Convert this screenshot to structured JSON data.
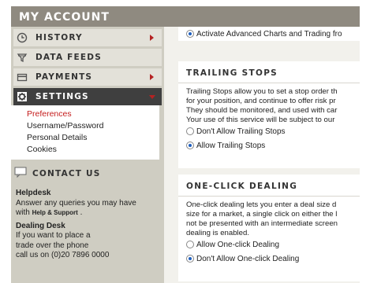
{
  "sidebar": {
    "title": "MY ACCOUNT",
    "menu": [
      {
        "label": "HISTORY",
        "icon": "history-icon",
        "arrow": "right"
      },
      {
        "label": "DATA FEEDS",
        "icon": "filter-icon",
        "arrow": "none"
      },
      {
        "label": "PAYMENTS",
        "icon": "card-icon",
        "arrow": "right"
      },
      {
        "label": "SETTINGS",
        "icon": "gear-icon",
        "arrow": "down",
        "active": true
      }
    ],
    "submenu": [
      "Preferences",
      "Username/Password",
      "Personal Details",
      "Cookies"
    ],
    "contact": {
      "title": "CONTACT US",
      "helpdesk_title": "Helpdesk",
      "helpdesk_text": "Answer any queries you may have",
      "helpdesk_with": "with",
      "helpdesk_link": "Help & Support",
      "helpdesk_end": ".",
      "dealing_title": "Dealing Desk",
      "dealing_line1": "If you want to place a",
      "dealing_line2": "trade over the phone",
      "dealing_line3": "call us on (0)20 7896 0000"
    }
  },
  "main": {
    "top_option": "Activate Advanced Charts and Trading fro",
    "trailing": {
      "title": "TRAILING STOPS",
      "lines": [
        "Trailing Stops allow you to set a stop order th",
        "for your position, and continue to offer risk pr",
        "They should be monitored, and used with car",
        "Your use of this service will be subject to our"
      ],
      "options": [
        "Don't Allow Trailing Stops",
        "Allow Trailing Stops"
      ]
    },
    "oneclick": {
      "title": "ONE-CLICK DEALING",
      "lines": [
        "One-click dealing lets you enter a deal size d",
        "size for a market, a single click on either the l",
        "not be presented with an intermediate screen",
        "dealing is enabled."
      ],
      "options": [
        "Allow One-click Dealing",
        "Don't Allow One-click Dealing"
      ]
    }
  },
  "colors": {
    "header": "#8f8a80",
    "sidebar_bg": "#cfcdc2",
    "active_item": "#3f3f3f",
    "accent_red": "#c41b1b",
    "radio_blue": "#1f5fbf"
  }
}
